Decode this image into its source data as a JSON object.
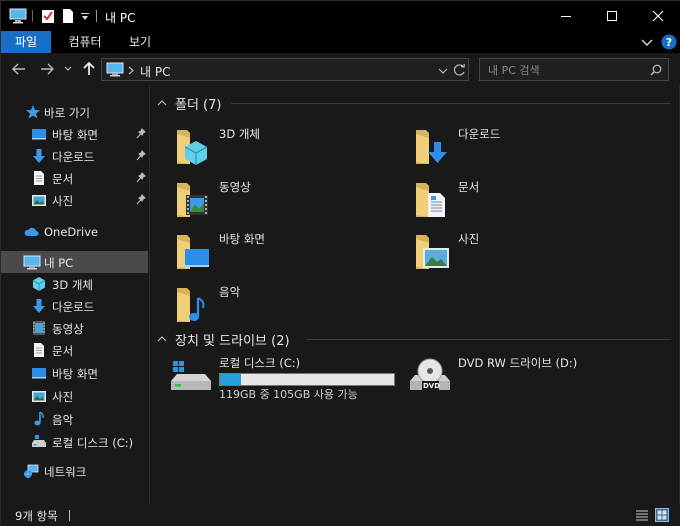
{
  "window": {
    "title": "내 PC"
  },
  "ribbon": {
    "tabs": [
      {
        "label": "파일",
        "active": true
      },
      {
        "label": "컴퓨터",
        "active": false
      },
      {
        "label": "보기",
        "active": false
      }
    ],
    "help_icon": "help-icon"
  },
  "address": {
    "path": "내 PC",
    "search_placeholder": "내 PC 검색"
  },
  "sidebar": {
    "quick_access": {
      "label": "바로 가기",
      "items": [
        {
          "label": "바탕 화면",
          "icon": "desktop-icon",
          "pinned": true
        },
        {
          "label": "다운로드",
          "icon": "download-icon",
          "pinned": true
        },
        {
          "label": "문서",
          "icon": "document-icon",
          "pinned": true
        },
        {
          "label": "사진",
          "icon": "picture-icon",
          "pinned": true
        }
      ]
    },
    "onedrive": {
      "label": "OneDrive"
    },
    "this_pc": {
      "label": "내 PC",
      "items": [
        {
          "label": "3D 개체",
          "icon": "3d-objects-icon"
        },
        {
          "label": "다운로드",
          "icon": "download-icon"
        },
        {
          "label": "동영상",
          "icon": "video-icon"
        },
        {
          "label": "문서",
          "icon": "document-icon"
        },
        {
          "label": "바탕 화면",
          "icon": "desktop-icon"
        },
        {
          "label": "사진",
          "icon": "picture-icon"
        },
        {
          "label": "음악",
          "icon": "music-icon"
        },
        {
          "label": "로컬 디스크 (C:)",
          "icon": "drive-icon"
        }
      ]
    },
    "network": {
      "label": "네트워크"
    }
  },
  "main": {
    "folders_group": {
      "title": "폴더 (7)",
      "items": [
        {
          "label": "3D 개체",
          "icon": "3d-objects-folder-icon"
        },
        {
          "label": "다운로드",
          "icon": "downloads-folder-icon"
        },
        {
          "label": "동영상",
          "icon": "videos-folder-icon"
        },
        {
          "label": "문서",
          "icon": "documents-folder-icon"
        },
        {
          "label": "바탕 화면",
          "icon": "desktop-folder-icon"
        },
        {
          "label": "사진",
          "icon": "pictures-folder-icon"
        },
        {
          "label": "음악",
          "icon": "music-folder-icon"
        }
      ]
    },
    "drives_group": {
      "title": "장치 및 드라이브 (2)",
      "items": [
        {
          "label": "로컬 디스크 (C:)",
          "detail": "119GB 중 105GB 사용 가능",
          "used_fraction": 0.12,
          "icon": "local-disk-icon"
        },
        {
          "label": "DVD RW 드라이브 (D:)",
          "icon": "dvd-drive-icon",
          "badge": "DVD"
        }
      ]
    }
  },
  "status": {
    "item_count": "9개 항목"
  },
  "colors": {
    "accent": "#1a6fc4",
    "background": "#191919",
    "folder": "#e8c46a",
    "progress": "#26a0da"
  }
}
